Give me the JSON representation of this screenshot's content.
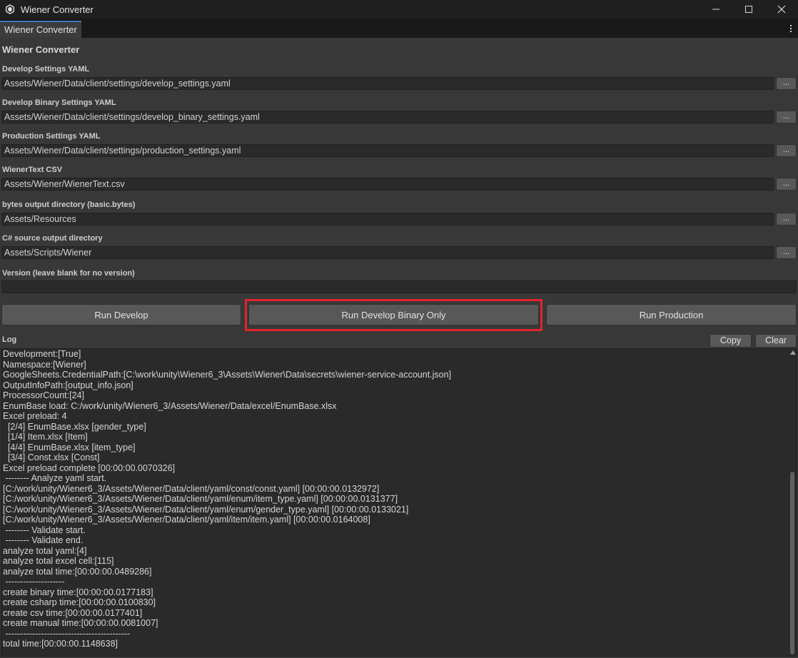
{
  "window": {
    "title": "Wiener Converter"
  },
  "tab": {
    "label": "Wiener Converter"
  },
  "panel": {
    "title": "Wiener Converter"
  },
  "fields": [
    {
      "label": "Develop Settings YAML",
      "value": "Assets/Wiener/Data/client/settings/develop_settings.yaml"
    },
    {
      "label": "Develop Binary Settings YAML",
      "value": "Assets/Wiener/Data/client/settings/develop_binary_settings.yaml"
    },
    {
      "label": "Production Settings YAML",
      "value": "Assets/Wiener/Data/client/settings/production_settings.yaml"
    },
    {
      "label": "WienerText CSV",
      "value": "Assets/Wiener/WienerText.csv"
    },
    {
      "label": "bytes output directory (basic.bytes)",
      "value": "Assets/Resources"
    },
    {
      "label": "C# source output directory",
      "value": "Assets/Scripts/Wiener"
    }
  ],
  "browse_label": "...",
  "version": {
    "label": "Version (leave blank for no version)",
    "value": ""
  },
  "actions": {
    "run_develop": "Run Develop",
    "run_develop_binary": "Run Develop Binary Only",
    "run_production": "Run Production"
  },
  "log": {
    "label": "Log",
    "copy": "Copy",
    "clear": "Clear",
    "lines": [
      "Development:[True]",
      "Namespace:[Wiener]",
      "GoogleSheets.CredentialPath:[C:\\work\\unity\\Wiener6_3\\Assets\\Wiener\\Data\\secrets\\wiener-service-account.json]",
      "OutputInfoPath:[output_info.json]",
      "ProcessorCount:[24]",
      "EnumBase load: C:/work/unity/Wiener6_3/Assets/Wiener/Data/excel/EnumBase.xlsx",
      "Excel preload: 4",
      "  [2/4] EnumBase.xlsx [gender_type]",
      "  [1/4] Item.xlsx [Item]",
      "  [4/4] EnumBase.xlsx [item_type]",
      "  [3/4] Const.xlsx [Const]",
      "Excel preload complete [00:00:00.0070326]",
      " -------- Analyze yaml start.",
      "[C:/work/unity/Wiener6_3/Assets/Wiener/Data/client/yaml/const/const.yaml] [00:00:00.0132972]",
      "[C:/work/unity/Wiener6_3/Assets/Wiener/Data/client/yaml/enum/item_type.yaml] [00:00:00.0131377]",
      "[C:/work/unity/Wiener6_3/Assets/Wiener/Data/client/yaml/enum/gender_type.yaml] [00:00:00.0133021]",
      "[C:/work/unity/Wiener6_3/Assets/Wiener/Data/client/yaml/item/item.yaml] [00:00:00.0164008]",
      " -------- Validate start.",
      " -------- Validate end.",
      "analyze total yaml:[4]",
      "analyze total excel cell:[115]",
      "analyze total time:[00:00:00.0489286]",
      " --------------------",
      "create binary time:[00:00:00.0177183]",
      "create csharp time:[00:00:00.0100830]",
      "create csv time:[00:00:00.0177401]",
      "create manual time:[00:00:00.0081007]",
      " ------------------------------------------",
      "total time:[00:00:00.1148638]"
    ]
  },
  "colors": {
    "background": "#383838",
    "input_bg": "#2a2a2a",
    "button_bg": "#585858",
    "highlight": "#e3232b",
    "tab_accent": "#3a79bb"
  }
}
